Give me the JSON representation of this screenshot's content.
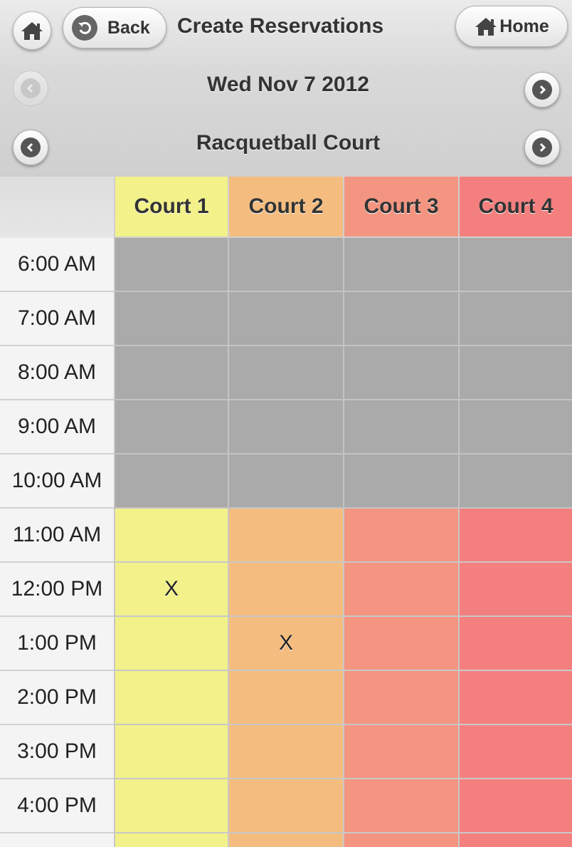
{
  "header": {
    "title": "Create Reservations",
    "back_label": "Back",
    "home_label": "Home"
  },
  "date_nav": {
    "label": "Wed Nov 7 2012",
    "prev_disabled": true
  },
  "facility_nav": {
    "label": "Racquetball Court"
  },
  "colors": {
    "court1": "#f2f18a",
    "court2": "#f4bd7f",
    "court3": "#f39581",
    "court4": "#f47f7f",
    "unavailable": "#aaaaaa"
  },
  "courts": [
    "Court 1",
    "Court 2",
    "Court 3",
    "Court 4"
  ],
  "slots": [
    {
      "time": "6:00 AM",
      "available": false,
      "marks": [
        "",
        "",
        "",
        ""
      ]
    },
    {
      "time": "7:00 AM",
      "available": false,
      "marks": [
        "",
        "",
        "",
        ""
      ]
    },
    {
      "time": "8:00 AM",
      "available": false,
      "marks": [
        "",
        "",
        "",
        ""
      ]
    },
    {
      "time": "9:00 AM",
      "available": false,
      "marks": [
        "",
        "",
        "",
        ""
      ]
    },
    {
      "time": "10:00 AM",
      "available": false,
      "marks": [
        "",
        "",
        "",
        ""
      ]
    },
    {
      "time": "11:00 AM",
      "available": true,
      "marks": [
        "",
        "",
        "",
        ""
      ]
    },
    {
      "time": "12:00 PM",
      "available": true,
      "marks": [
        "X",
        "",
        "",
        ""
      ]
    },
    {
      "time": "1:00 PM",
      "available": true,
      "marks": [
        "",
        "X",
        "",
        ""
      ]
    },
    {
      "time": "2:00 PM",
      "available": true,
      "marks": [
        "",
        "",
        "",
        ""
      ]
    },
    {
      "time": "3:00 PM",
      "available": true,
      "marks": [
        "",
        "",
        "",
        ""
      ]
    },
    {
      "time": "4:00 PM",
      "available": true,
      "marks": [
        "",
        "",
        "",
        ""
      ]
    },
    {
      "time": "",
      "available": true,
      "marks": [
        "",
        "",
        "",
        ""
      ]
    }
  ]
}
